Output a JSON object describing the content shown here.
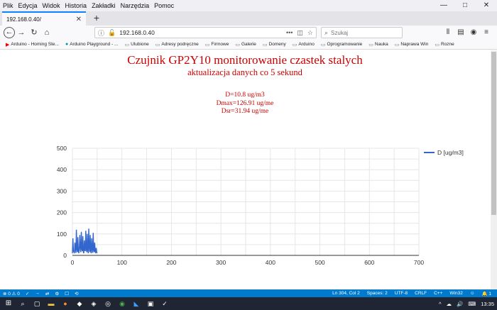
{
  "menu": [
    "Plik",
    "Edycja",
    "Widok",
    "Historia",
    "Zakładki",
    "Narzędzia",
    "Pomoc"
  ],
  "window_controls": {
    "minimize": "—",
    "maximize": "□",
    "close": "✕"
  },
  "tab": {
    "label": "192.168.0.40/",
    "close": "✕",
    "new_tab": "+"
  },
  "nav": {
    "back": "←",
    "forward": "→",
    "reload": "↻",
    "home": "⌂",
    "url": "192.168.0.40",
    "more": "•••",
    "search_placeholder": "Szukaj",
    "icons": [
      "library-icon",
      "sidebar-icon",
      "account-icon",
      "menu-icon"
    ]
  },
  "bookmarks": [
    {
      "label": "Arduino - Homing Ste...",
      "icon": "youtube-icon"
    },
    {
      "label": "Arduino Playground - ...",
      "icon": "arduino-icon"
    },
    {
      "label": "Ulubione",
      "icon": "folder-icon"
    },
    {
      "label": "Adresy podręczne",
      "icon": "folder-icon"
    },
    {
      "label": "Firmowe",
      "icon": "folder-icon"
    },
    {
      "label": "Galerie",
      "icon": "folder-icon"
    },
    {
      "label": "Domeny",
      "icon": "folder-icon"
    },
    {
      "label": "Arduino",
      "icon": "folder-icon"
    },
    {
      "label": "Oprogramowanie",
      "icon": "folder-icon"
    },
    {
      "label": "Nauka",
      "icon": "folder-icon"
    },
    {
      "label": "Naprawa Win",
      "icon": "folder-icon"
    },
    {
      "label": "Rozne",
      "icon": "folder-icon"
    }
  ],
  "page": {
    "title": "Czujnik GP2Y10 monitorowanie czastek stalych",
    "subtitle": "aktualizacja danych co 5 sekund",
    "stats": [
      "D=10.8 ug/m3",
      "Dmax=126.91 ug/me",
      "Dsr=31.94 ug/me"
    ]
  },
  "chart_data": {
    "type": "line",
    "xlim": [
      0,
      700
    ],
    "ylim": [
      0,
      500
    ],
    "x_ticks": [
      0,
      100,
      200,
      300,
      400,
      500,
      600,
      700
    ],
    "y_ticks": [
      0,
      100,
      200,
      300,
      400,
      500
    ],
    "grid": true,
    "legend_position": "right",
    "color": "#3366cc",
    "series": [
      {
        "name": "D [ug/m3]",
        "x": [
          0,
          1,
          2,
          3,
          4,
          5,
          6,
          7,
          8,
          9,
          10,
          11,
          12,
          13,
          14,
          15,
          16,
          17,
          18,
          19,
          20,
          21,
          22,
          23,
          24,
          25,
          26,
          27,
          28,
          29,
          30,
          31,
          32,
          33,
          34,
          35,
          36,
          37,
          38,
          39,
          40,
          41,
          42,
          43,
          44,
          45,
          46,
          47,
          48,
          49,
          50
        ],
        "y": [
          10,
          80,
          20,
          15,
          10,
          60,
          25,
          12,
          120,
          30,
          15,
          85,
          20,
          10,
          40,
          95,
          25,
          15,
          110,
          30,
          20,
          90,
          15,
          10,
          70,
          25,
          20,
          115,
          30,
          15,
          100,
          25,
          10,
          125,
          35,
          15,
          95,
          20,
          10,
          80,
          30,
          12,
          105,
          25,
          15,
          60,
          20,
          10,
          35,
          15,
          10.8
        ]
      }
    ]
  },
  "statusbar": {
    "left": [
      "⊗ 0 ⚠ 0",
      "✓",
      "→",
      "⇄",
      "⚙",
      "☐",
      "⟲"
    ],
    "right": [
      "Ln 304, Col 2",
      "Spaces: 2",
      "UTF-8",
      "CRLF",
      "C++",
      "Win32",
      "☺",
      "🔔 1"
    ]
  },
  "taskbar": {
    "time": "13:35",
    "tray": [
      "^",
      "☁",
      "🔊",
      "⌨"
    ]
  }
}
